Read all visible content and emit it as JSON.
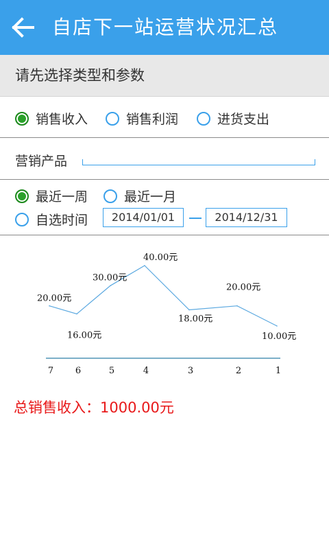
{
  "header": {
    "title": "自店下一站运营状况汇总"
  },
  "section": {
    "title": "请先选择类型和参数"
  },
  "type_options": [
    {
      "label": "销售收入",
      "selected": true
    },
    {
      "label": "销售利润",
      "selected": false
    },
    {
      "label": "进货支出",
      "selected": false
    }
  ],
  "product": {
    "label": "营销产品",
    "value": ""
  },
  "period_options": [
    {
      "label": "最近一周",
      "selected": true
    },
    {
      "label": "最近一月",
      "selected": false
    },
    {
      "label": "自选时间",
      "selected": false
    }
  ],
  "custom_range": {
    "start": "2014/01/01",
    "end": "2014/12/31"
  },
  "chart_data": {
    "type": "line",
    "categories": [
      "7",
      "6",
      "5",
      "4",
      "3",
      "2",
      "1"
    ],
    "values": [
      20.0,
      16.0,
      30.0,
      40.0,
      18.0,
      20.0,
      10.0
    ],
    "value_labels": [
      "20.00元",
      "16.00元",
      "30.00元",
      "40.00元",
      "18.00元",
      "20.00元",
      "10.00元"
    ],
    "line_color": "#5aa8e0",
    "axis_color": "#2f7fa8"
  },
  "summary": {
    "label": "总销售收入：",
    "value": "1000.00元"
  },
  "colors": {
    "accent": "#3aa0ea",
    "selected_radio": "#2aa12a",
    "total_text": "#e8191a"
  }
}
